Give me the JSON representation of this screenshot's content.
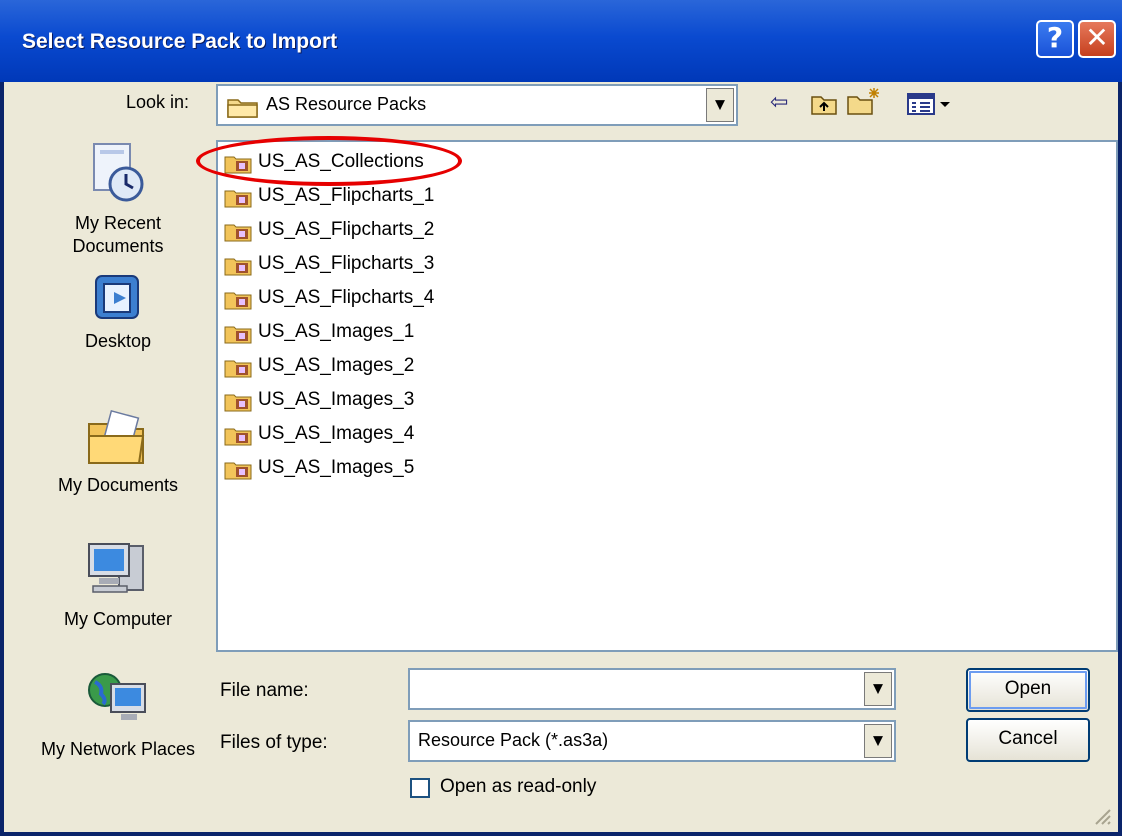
{
  "window": {
    "title": "Select Resource Pack to Import",
    "help_glyph": "?",
    "close_glyph": "✕"
  },
  "lookin": {
    "label": "Look in:",
    "value": "AS Resource Packs",
    "folder_icon": "folder-icon",
    "arrow": "▼"
  },
  "toolbar": {
    "back_glyph": "⇦",
    "up_icon": "up-folder-icon",
    "new_folder_icon": "new-folder-icon",
    "views_icon": "views-menu-icon"
  },
  "places": [
    {
      "label": "My Recent Documents",
      "icon": "recent-documents-icon"
    },
    {
      "label": "Desktop",
      "icon": "desktop-icon"
    },
    {
      "label": "My Documents",
      "icon": "my-documents-icon"
    },
    {
      "label": "My Computer",
      "icon": "my-computer-icon"
    },
    {
      "label": "My Network Places",
      "icon": "network-places-icon"
    }
  ],
  "files": [
    "US_AS_Collections",
    "US_AS_Flipcharts_1",
    "US_AS_Flipcharts_2",
    "US_AS_Flipcharts_3",
    "US_AS_Flipcharts_4",
    "US_AS_Images_1",
    "US_AS_Images_2",
    "US_AS_Images_3",
    "US_AS_Images_4",
    "US_AS_Images_5"
  ],
  "highlighted_file": "US_AS_Collections",
  "form": {
    "file_name_label": "File name:",
    "file_name_value": "",
    "file_type_label": "Files of type:",
    "file_type_value": "Resource Pack (*.as3a)",
    "read_only_label": "Open as read-only",
    "read_only_checked": false
  },
  "buttons": {
    "open": "Open",
    "cancel": "Cancel"
  },
  "colors": {
    "title_bar": "#0a4ad0",
    "dialog_bg": "#ece9d8",
    "highlight_ellipse": "#e60000"
  }
}
